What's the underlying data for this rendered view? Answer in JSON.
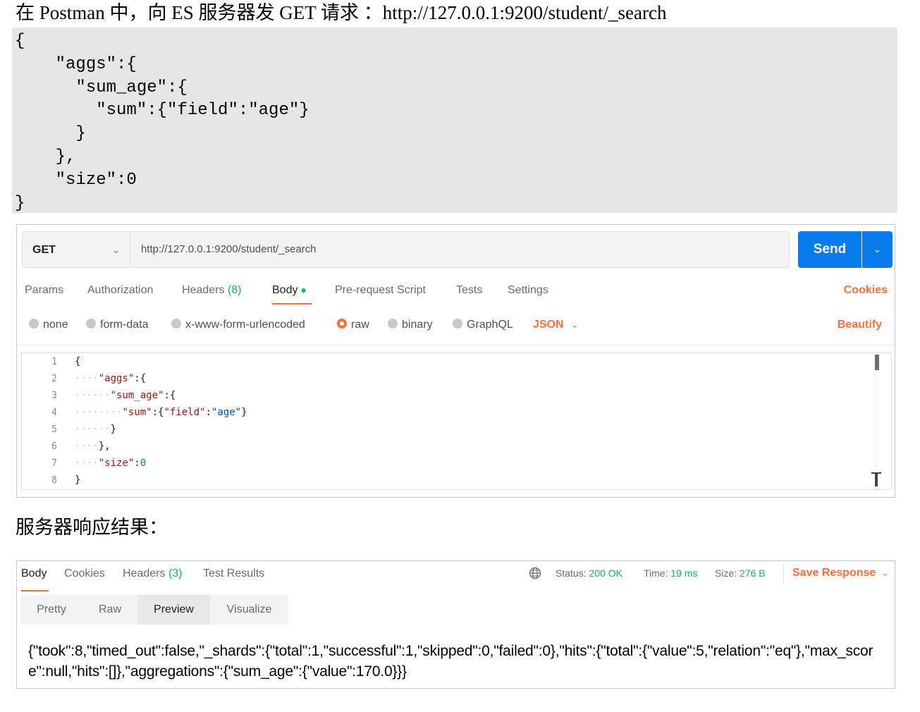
{
  "doc": {
    "heading": "在 Postman 中，向 ES 服务器发 GET 请求 ：http://127.0.0.1:9200/student/_search",
    "code_lines": [
      "{",
      "    \"aggs\":{",
      "      \"sum_age\":{",
      "        \"sum\":{\"field\":\"age\"}",
      "      }",
      "    },",
      "    \"size\":0",
      "}"
    ],
    "response_heading": "服务器响应结果："
  },
  "request": {
    "method": "GET",
    "url": "http://127.0.0.1:9200/student/_search",
    "send_label": "Send",
    "tabs": {
      "params": "Params",
      "authorization": "Authorization",
      "headers": "Headers",
      "headers_count": "(8)",
      "body": "Body",
      "pre_request": "Pre-request Script",
      "tests": "Tests",
      "settings": "Settings",
      "cookies": "Cookies"
    },
    "body_types": {
      "none": "none",
      "form_data": "form-data",
      "urlencoded": "x-www-form-urlencoded",
      "raw": "raw",
      "binary": "binary",
      "graphql": "GraphQL",
      "selected": "raw"
    },
    "format": "JSON",
    "beautify": "Beautify",
    "editor": {
      "line_numbers": [
        "1",
        "2",
        "3",
        "4",
        "5",
        "6",
        "7",
        "8"
      ]
    }
  },
  "response": {
    "tabs": {
      "body": "Body",
      "cookies": "Cookies",
      "headers": "Headers",
      "headers_count": "(3)",
      "test_results": "Test Results"
    },
    "status_label": "Status:",
    "status_value": "200 OK",
    "time_label": "Time:",
    "time_value": "19 ms",
    "size_label": "Size:",
    "size_value": "276 B",
    "save_label": "Save Response",
    "views": {
      "pretty": "Pretty",
      "raw": "Raw",
      "preview": "Preview",
      "visualize": "Visualize",
      "selected": "Preview"
    },
    "body_text": "{\"took\":8,\"timed_out\":false,\"_shards\":{\"total\":1,\"successful\":1,\"skipped\":0,\"failed\":0},\"hits\":{\"total\":{\"value\":5,\"relation\":\"eq\"},\"max_score\":null,\"hits\":[]},\"aggregations\":{\"sum_age\":{\"value\":170.0}}}"
  },
  "colors": {
    "accent": "#ff6c37",
    "send": "#097bed",
    "success": "#0cbb52"
  }
}
